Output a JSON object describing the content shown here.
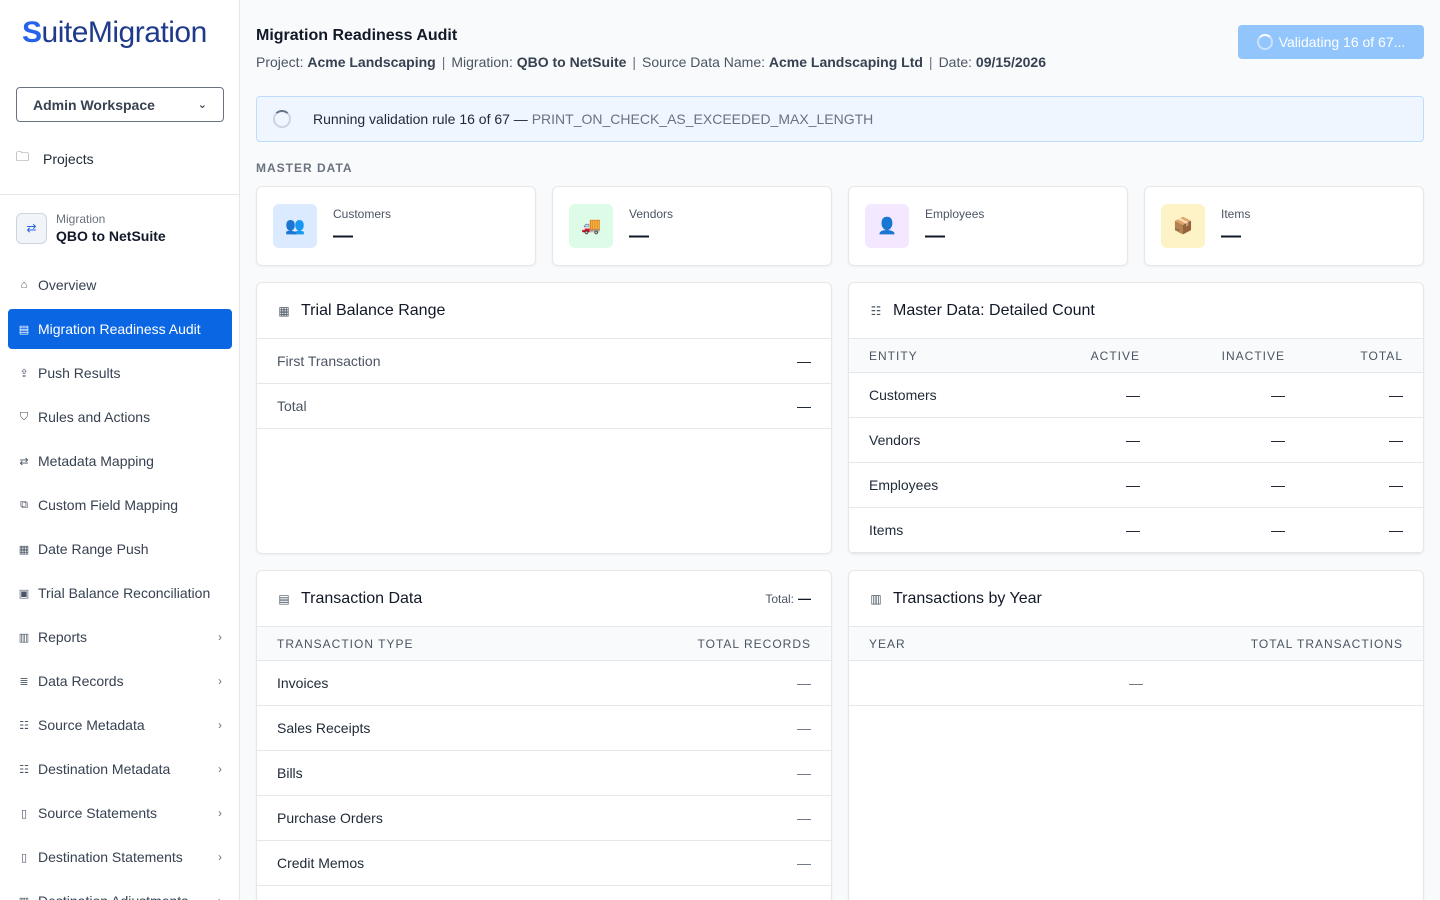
{
  "brand": {
    "logo_first": "S",
    "logo_rest": "uiteMigration"
  },
  "workspace": {
    "label": "Admin Workspace"
  },
  "projects_label": "Projects",
  "migration": {
    "label": "Migration",
    "name": "QBO to NetSuite"
  },
  "nav": [
    {
      "label": "Overview",
      "icon": "home-icon",
      "glyph": "⌂",
      "arrow": "",
      "active": false
    },
    {
      "label": "Migration Readiness Audit",
      "icon": "clipboard-icon",
      "glyph": "▤",
      "arrow": "",
      "active": true
    },
    {
      "label": "Push Results",
      "icon": "upload-icon",
      "glyph": "⇪",
      "arrow": "",
      "active": false
    },
    {
      "label": "Rules and Actions",
      "icon": "shield-icon",
      "glyph": "⛉",
      "arrow": "",
      "active": false
    },
    {
      "label": "Metadata Mapping",
      "icon": "swap-icon",
      "glyph": "⇄",
      "arrow": "",
      "active": false
    },
    {
      "label": "Custom Field Mapping",
      "icon": "fields-icon",
      "glyph": "⧉",
      "arrow": "",
      "active": false
    },
    {
      "label": "Date Range Push",
      "icon": "calendar-icon",
      "glyph": "▦",
      "arrow": "",
      "active": false
    },
    {
      "label": "Trial Balance Reconciliation",
      "icon": "receipt-icon",
      "glyph": "▣",
      "arrow": "",
      "active": false
    },
    {
      "label": "Reports",
      "icon": "bar-chart-icon",
      "glyph": "▥",
      "arrow": "›",
      "active": false
    },
    {
      "label": "Data Records",
      "icon": "database-icon",
      "glyph": "≣",
      "arrow": "›",
      "active": false
    },
    {
      "label": "Source Metadata",
      "icon": "list-icon",
      "glyph": "☷",
      "arrow": "›",
      "active": false
    },
    {
      "label": "Destination Metadata",
      "icon": "list-icon",
      "glyph": "☷",
      "arrow": "›",
      "active": false
    },
    {
      "label": "Source Statements",
      "icon": "document-icon",
      "glyph": "▯",
      "arrow": "›",
      "active": false
    },
    {
      "label": "Destination Statements",
      "icon": "document-icon",
      "glyph": "▯",
      "arrow": "›",
      "active": false
    },
    {
      "label": "Destination Adjustments",
      "icon": "chart-icon",
      "glyph": "▥",
      "arrow": "›",
      "active": false
    }
  ],
  "header": {
    "title": "Migration Readiness Audit",
    "project_label": "Project:",
    "project": "Acme Landscaping",
    "migration_label": "Migration:",
    "migration": "QBO to NetSuite",
    "source_label": "Source Data Name:",
    "source": "Acme Landscaping Ltd",
    "date_label": "Date:",
    "date": "09/15/2026",
    "sep": "|"
  },
  "validate_button": "Validating 16 of 67...",
  "running": {
    "text": "Running validation rule 16 of 67 —",
    "rule": "PRINT_ON_CHECK_AS_EXCEEDED_MAX_LENGTH"
  },
  "section_master": "MASTER DATA",
  "stats": [
    {
      "label": "Customers",
      "value": "—",
      "icon": "users-icon",
      "glyph": "👥",
      "bg": "#dbeafe",
      "fg": "#2563eb"
    },
    {
      "label": "Vendors",
      "value": "—",
      "icon": "truck-icon",
      "glyph": "🚚",
      "bg": "#dcfce7",
      "fg": "#16a34a"
    },
    {
      "label": "Employees",
      "value": "—",
      "icon": "user-icon",
      "glyph": "👤",
      "bg": "#f3e8ff",
      "fg": "#9333ea"
    },
    {
      "label": "Items",
      "value": "—",
      "icon": "box-icon",
      "glyph": "📦",
      "bg": "#fef3c7",
      "fg": "#d97706"
    }
  ],
  "trial_balance": {
    "title": "Trial Balance Range",
    "rows": [
      {
        "label": "First Transaction",
        "value": "—"
      },
      {
        "label": "Total",
        "value": "—"
      }
    ]
  },
  "master_detail": {
    "title": "Master Data: Detailed Count",
    "headers": [
      "ENTITY",
      "ACTIVE",
      "INACTIVE",
      "TOTAL"
    ],
    "rows": [
      {
        "entity": "Customers",
        "active": "—",
        "inactive": "—",
        "total": "—"
      },
      {
        "entity": "Vendors",
        "active": "—",
        "inactive": "—",
        "total": "—"
      },
      {
        "entity": "Employees",
        "active": "—",
        "inactive": "—",
        "total": "—"
      },
      {
        "entity": "Items",
        "active": "—",
        "inactive": "—",
        "total": "—"
      }
    ]
  },
  "transaction_data": {
    "title": "Transaction Data",
    "total_label": "Total:",
    "total_value": "—",
    "headers": [
      "TRANSACTION TYPE",
      "TOTAL RECORDS"
    ],
    "rows": [
      {
        "type": "Invoices",
        "value": "—"
      },
      {
        "type": "Sales Receipts",
        "value": "—"
      },
      {
        "type": "Bills",
        "value": "—"
      },
      {
        "type": "Purchase Orders",
        "value": "—"
      },
      {
        "type": "Credit Memos",
        "value": "—"
      }
    ]
  },
  "transactions_by_year": {
    "title": "Transactions by Year",
    "headers": [
      "YEAR",
      "TOTAL TRANSACTIONS"
    ],
    "empty_value": "—"
  }
}
